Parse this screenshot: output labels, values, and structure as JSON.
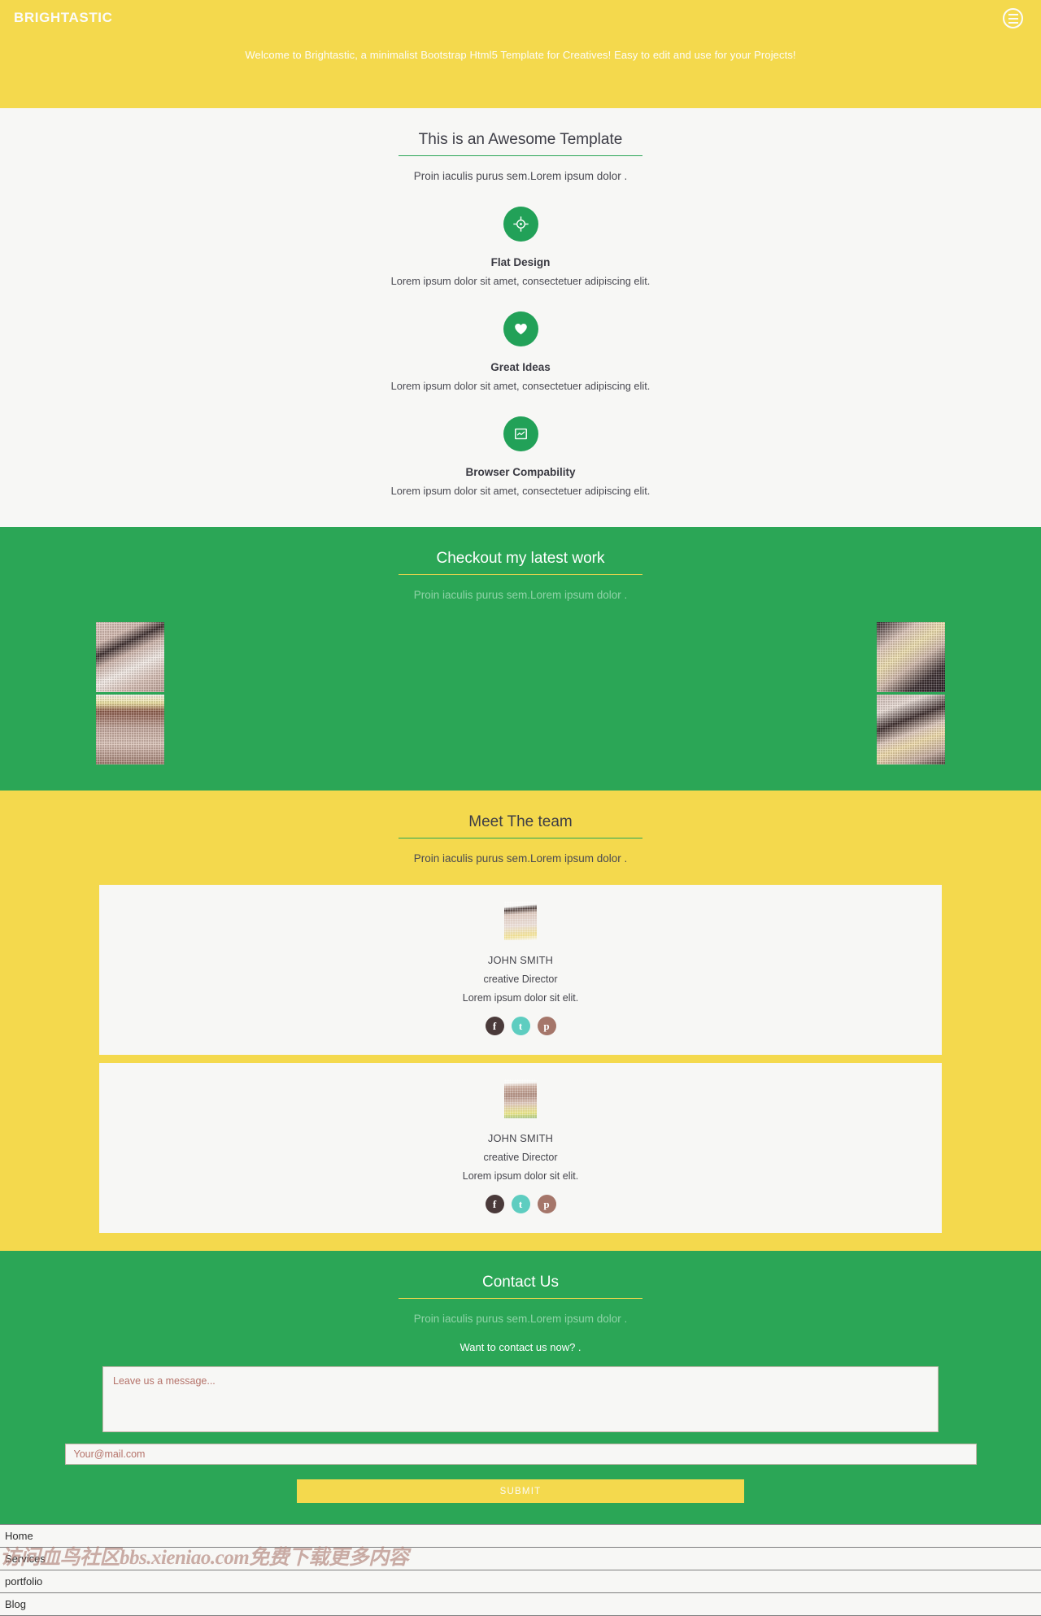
{
  "hero": {
    "brand": "BRIGHTASTIC",
    "tagline": "Welcome to Brightastic, a minimalist Bootstrap Html5 Template for Creatives! Easy to edit and use for your Projects!",
    "menu_icon": "hamburger-icon",
    "bg_color": "#f4d94d"
  },
  "features": {
    "title": "This is an Awesome Template",
    "subtitle": "Proin iaculis purus sem.Lorem ipsum dolor .",
    "accent_color": "#2ba656",
    "items": [
      {
        "icon": "crosshair-target-icon",
        "title": "Flat Design",
        "desc": "Lorem ipsum dolor sit amet, consectetuer adipiscing elit."
      },
      {
        "icon": "heart-icon",
        "title": "Great Ideas",
        "desc": "Lorem ipsum dolor sit amet, consectetuer adipiscing elit."
      },
      {
        "icon": "browser-window-icon",
        "title": "Browser Compability",
        "desc": "Lorem ipsum dolor sit amet, consectetuer adipiscing elit."
      }
    ]
  },
  "portfolio": {
    "title": "Checkout my latest work",
    "subtitle": "Proin iaculis purus sem.Lorem ipsum dolor .",
    "bg_color": "#2ba656",
    "rule_color": "#f0d64c",
    "thumbnails": [
      {
        "name": "portfolio-thumb-1",
        "column": 1
      },
      {
        "name": "portfolio-thumb-2",
        "column": 1
      },
      {
        "name": "portfolio-thumb-3",
        "column": 4
      },
      {
        "name": "portfolio-thumb-4",
        "column": 4
      }
    ]
  },
  "team": {
    "title": "Meet The team",
    "subtitle": "Proin iaculis purus sem.Lorem ipsum dolor .",
    "bg_color": "#f4d94d",
    "members": [
      {
        "name": "JOHN SMITH",
        "role": "creative Director",
        "desc": "Lorem ipsum dolor sit elit.",
        "socials": [
          {
            "icon": "facebook-icon",
            "glyph": "f",
            "color": "#4a3a3a"
          },
          {
            "icon": "twitter-icon",
            "glyph": "t",
            "color": "#5ecdc0"
          },
          {
            "icon": "pinterest-icon",
            "glyph": "p",
            "color": "#a5766a"
          }
        ]
      },
      {
        "name": "JOHN SMITH",
        "role": "creative Director",
        "desc": "Lorem ipsum dolor sit elit.",
        "socials": [
          {
            "icon": "facebook-icon",
            "glyph": "f",
            "color": "#4a3a3a"
          },
          {
            "icon": "twitter-icon",
            "glyph": "t",
            "color": "#5ecdc0"
          },
          {
            "icon": "pinterest-icon",
            "glyph": "p",
            "color": "#a5766a"
          }
        ]
      }
    ]
  },
  "contact": {
    "title": "Contact Us",
    "subtitle": "Proin iaculis purus sem.Lorem ipsum dolor .",
    "cta": "Want to contact us now? .",
    "bg_color": "#2ba656",
    "message_placeholder": "Leave us a message...",
    "message_value": "",
    "email_placeholder": "Your@mail.com",
    "email_value": "",
    "submit_label": "SUBMIT"
  },
  "footer": {
    "items": [
      {
        "label": "Home"
      },
      {
        "label": "Services"
      },
      {
        "label": "portfolio"
      },
      {
        "label": "Blog"
      }
    ]
  },
  "watermark": {
    "text": "访问血鸟社区bbs.xieniao.com免费下载更多内容"
  }
}
